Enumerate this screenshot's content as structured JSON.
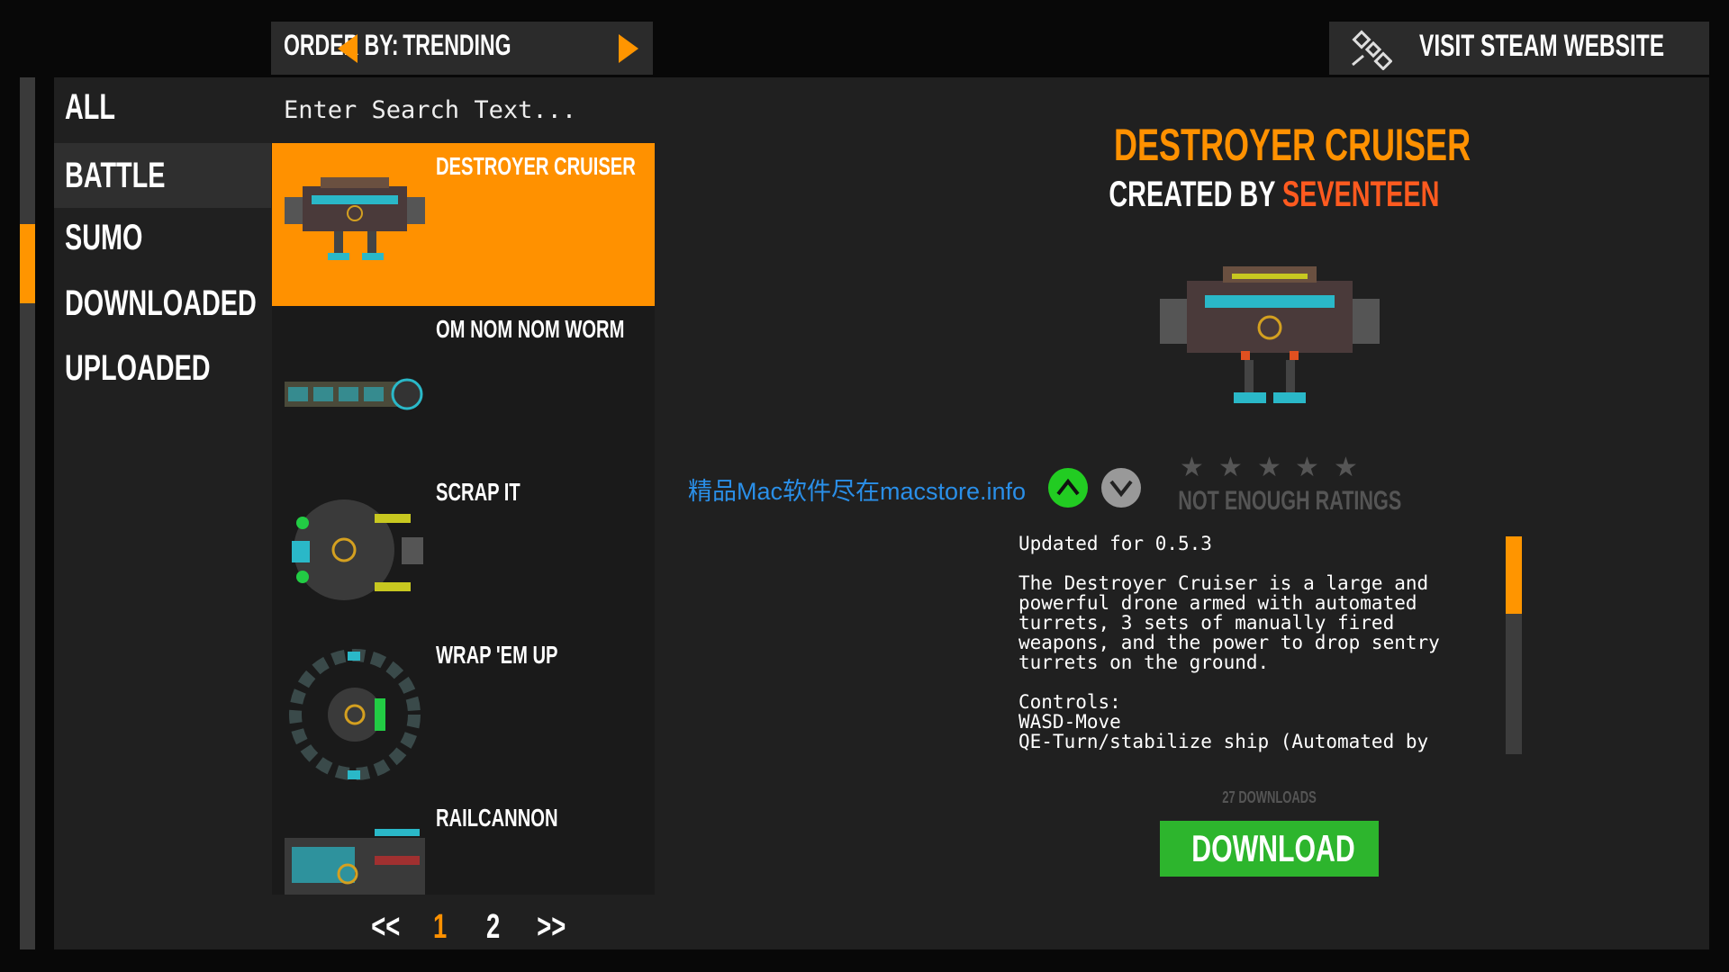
{
  "order_by": {
    "label": "ORDER BY:",
    "value": "TRENDING"
  },
  "steam_button": {
    "label": "VISIT STEAM WEBSITE",
    "icon": "satellite-icon"
  },
  "categories": [
    {
      "label": "ALL"
    },
    {
      "label": "BATTLE",
      "selected": true
    },
    {
      "label": "SUMO"
    },
    {
      "label": "DOWNLOADED"
    },
    {
      "label": "UPLOADED"
    }
  ],
  "search": {
    "placeholder": "Enter Search Text..."
  },
  "items": [
    {
      "name": "DESTROYER CRUISER",
      "selected": true
    },
    {
      "name": "OM NOM NOM WORM"
    },
    {
      "name": "SCRAP IT"
    },
    {
      "name": "WRAP 'EM UP"
    },
    {
      "name": "RAILCANNON"
    }
  ],
  "pagination": {
    "first": "<<",
    "pages": [
      "1",
      "2"
    ],
    "current": "1",
    "last": ">>"
  },
  "detail": {
    "title": "DESTROYER CRUISER",
    "created_by": "CREATED BY",
    "author": "SEVENTEEN",
    "watermark": "精品Mac软件尽在macstore.info",
    "rating_text": "NOT ENOUGH RATINGS",
    "stars": 0,
    "description": [
      "Updated for 0.5.3",
      "",
      "The Destroyer Cruiser is a large and",
      "powerful drone armed with automated",
      "turrets, 3 sets of manually fired",
      "weapons, and the power to drop sentry",
      "turrets on the ground.",
      "",
      "Controls:",
      "WASD-Move",
      "QE-Turn/stabilize ship (Automated by"
    ],
    "downloads": "27 DOWNLOADS",
    "download_label": "DOWNLOAD"
  },
  "colors": {
    "accent": "#ff9100",
    "author": "#ff5a1f",
    "download": "#2db52d",
    "upvote": "#22cc22",
    "watermark": "#2a8fe8"
  }
}
